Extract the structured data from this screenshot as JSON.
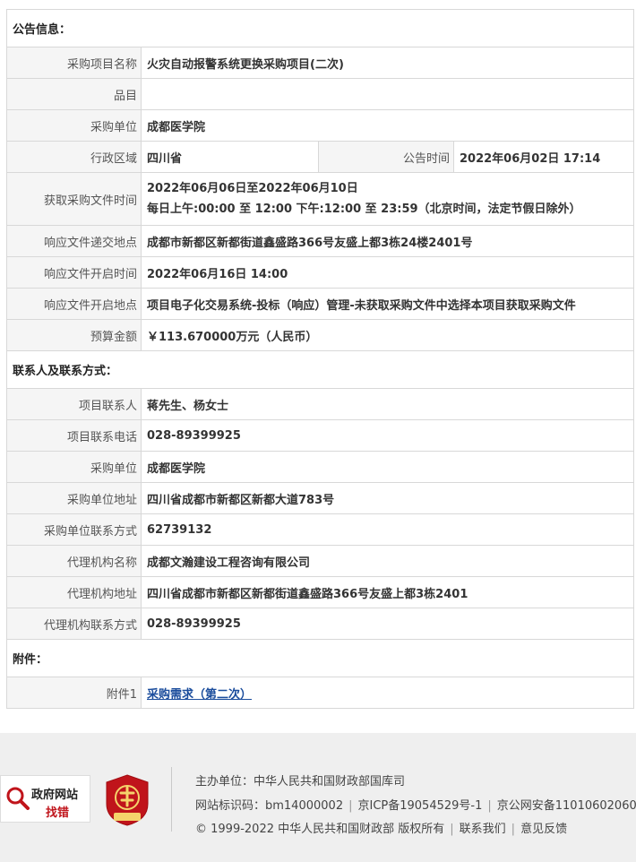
{
  "sections": {
    "announcement": "公告信息：",
    "contacts": "联系人及联系方式：",
    "attachments": "附件："
  },
  "fields": {
    "project_name": {
      "label": "采购项目名称",
      "value": "火灾自动报警系统更换采购项目(二次)"
    },
    "category": {
      "label": "品目",
      "value": ""
    },
    "purchaser": {
      "label": "采购单位",
      "value": "成都医学院"
    },
    "region": {
      "label": "行政区域",
      "value": "四川省"
    },
    "announce_time": {
      "label": "公告时间",
      "value": "2022年06月02日 17:14"
    },
    "doc_time": {
      "label": "获取采购文件时间",
      "line1": "2022年06月06日至2022年06月10日",
      "line2": "每日上午:00:00 至 12:00  下午:12:00 至 23:59（北京时间，法定节假日除外）"
    },
    "submit_place": {
      "label": "响应文件递交地点",
      "value": "成都市新都区新都街道鑫盛路366号友盛上都3栋24楼2401号"
    },
    "open_time": {
      "label": "响应文件开启时间",
      "value": "2022年06月16日 14:00"
    },
    "open_place": {
      "label": "响应文件开启地点",
      "value": "项目电子化交易系统-投标（响应）管理-未获取采购文件中选择本项目获取采购文件"
    },
    "budget": {
      "label": "预算金额",
      "value": "￥113.670000万元（人民币）"
    },
    "contact_person": {
      "label": "项目联系人",
      "value": "蒋先生、杨女士"
    },
    "contact_phone": {
      "label": "项目联系电话",
      "value": "028-89399925"
    },
    "purchaser2": {
      "label": "采购单位",
      "value": "成都医学院"
    },
    "purchaser_addr": {
      "label": "采购单位地址",
      "value": "四川省成都市新都区新都大道783号"
    },
    "purchaser_contact": {
      "label": "采购单位联系方式",
      "value": "62739132"
    },
    "agency_name": {
      "label": "代理机构名称",
      "value": "成都文瀚建设工程咨询有限公司"
    },
    "agency_addr": {
      "label": "代理机构地址",
      "value": "四川省成都市新都区新都街道鑫盛路366号友盛上都3栋2401"
    },
    "agency_contact": {
      "label": "代理机构联系方式",
      "value": "028-89399925"
    },
    "attachment1": {
      "label": "附件1",
      "value": "采购需求（第二次）"
    }
  },
  "footer": {
    "badge_line1": "政府网站",
    "badge_line2": "找错",
    "emblem_icon": "party-emblem-icon",
    "host": "主办单位：中华人民共和国财政部国库司",
    "site_id": "网站标识码：bm14000002",
    "icp": "京ICP备19054529号-1",
    "police": "京公网安备11010602060",
    "copyright": "© 1999-2022 中华人民共和国财政部 版权所有",
    "contact_us": "联系我们",
    "feedback": "意见反馈"
  }
}
